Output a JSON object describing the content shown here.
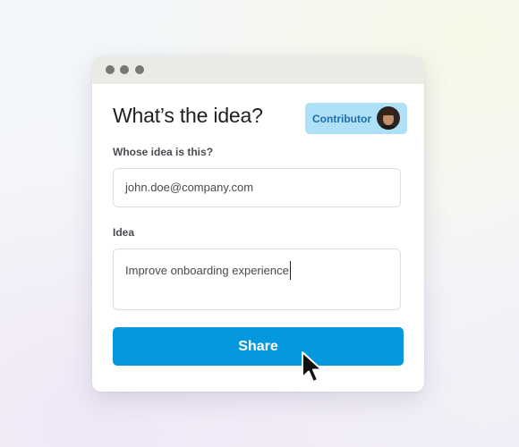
{
  "form": {
    "title": "What’s the idea?",
    "role_badge": "Contributor",
    "owner_label": "Whose idea is this?",
    "owner_value": "john.doe@company.com",
    "idea_label": "Idea",
    "idea_value": "Improve onboarding experience",
    "submit_label": "Share"
  },
  "colors": {
    "accent": "#0598de",
    "badge_bg": "#aee1f6",
    "badge_text": "#1f6ea8",
    "titlebar": "#ebebe6"
  },
  "icons": {
    "window_controls": [
      "window-dot-icon",
      "window-dot-icon",
      "window-dot-icon"
    ],
    "pointer": "mouse-pointer-icon"
  }
}
